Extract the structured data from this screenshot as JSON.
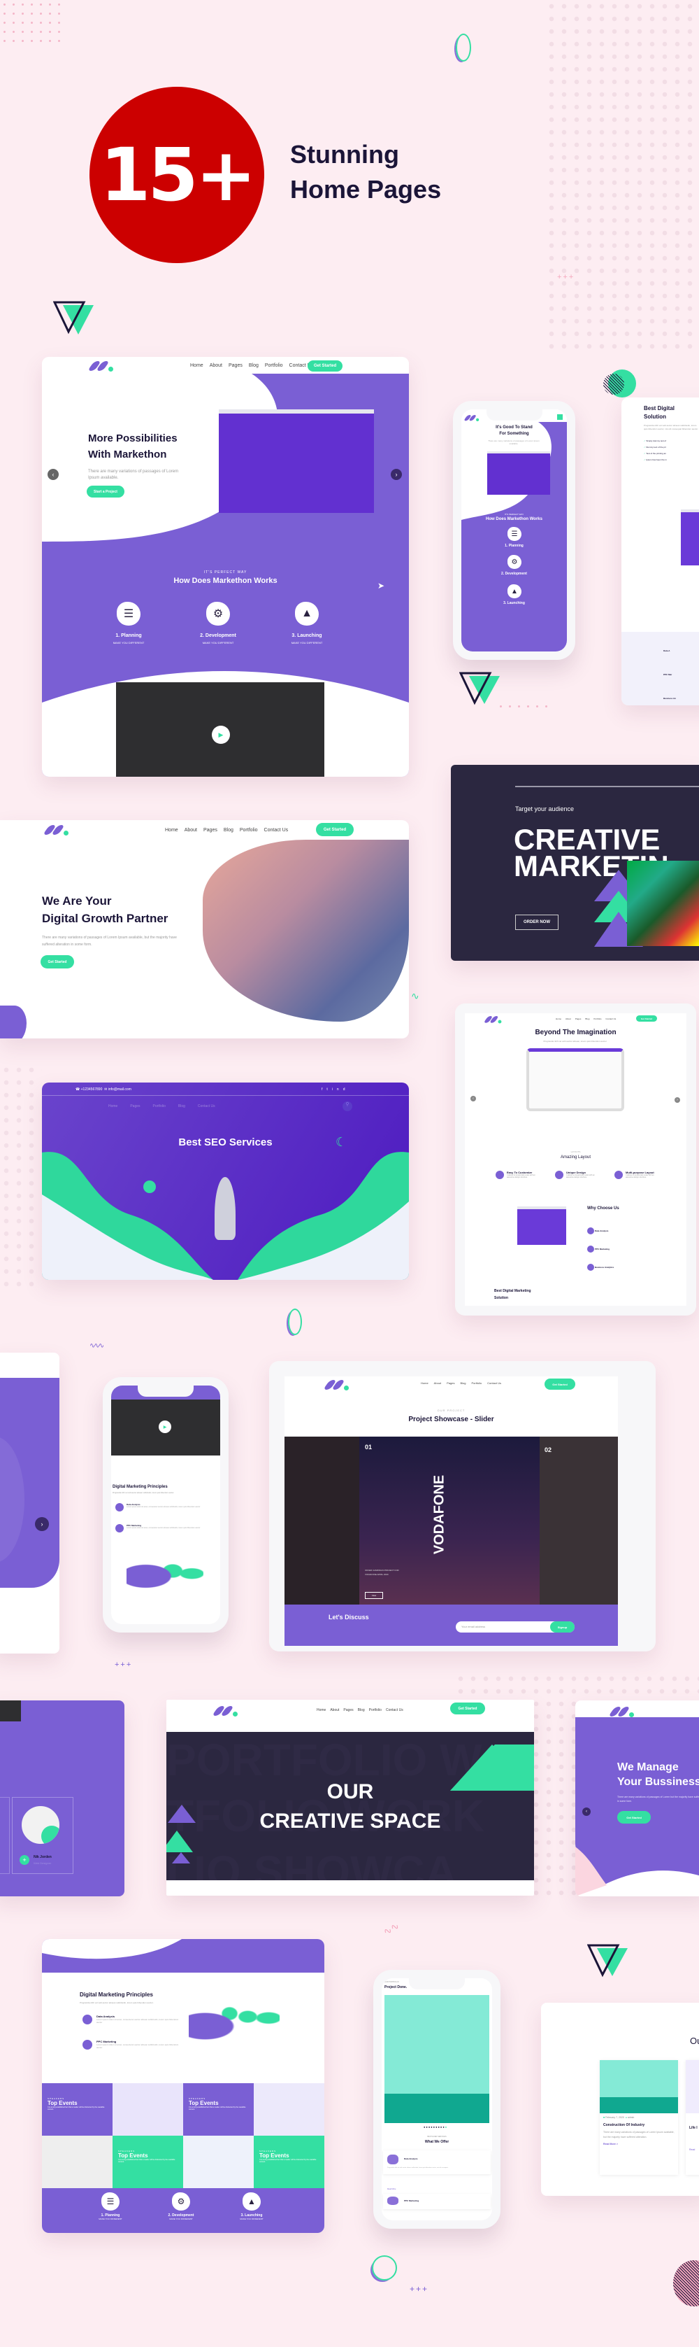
{
  "hero": {
    "badge": "15+",
    "title_line1": "Stunning",
    "title_line2": "Home Pages",
    "badge_color": "#cc0000"
  },
  "colors": {
    "purple": "#7a5fd4",
    "green": "#34dfa2",
    "dark": "#2b2740",
    "background": "#fdedf2"
  },
  "common_nav": [
    "Home",
    "About",
    "Pages",
    "Blog",
    "Portfolio",
    "Contact Us"
  ],
  "common_cta": "Get Started",
  "demo1": {
    "title_line1": "More Possibilities",
    "title_line2": "With Markethon",
    "desc": "There are many variations of passages of Lorem Ipsum available.",
    "button": "Start a Project",
    "kicker": "IT'S PERFECT WAY",
    "section_title": "How Does Markethon Works",
    "steps": [
      {
        "title": "1. Planning",
        "sub": "MAKE YOU DIFFERENT"
      },
      {
        "title": "2. Development",
        "sub": "MAKE YOU DIFFERENT"
      },
      {
        "title": "3. Launching",
        "sub": "MAKE YOU DIFFERENT"
      }
    ]
  },
  "phone1": {
    "title_line1": "It's Good To Stand",
    "title_line2": "For Something",
    "desc": "There are many variations of passages of Lorem Ipsum available.",
    "kicker": "IT'S PERFECT WAY",
    "section_title": "How Does Markethon Works",
    "steps": [
      "1. Planning",
      "2. Development",
      "3. Launching"
    ],
    "step_sub": "MAKE YOU DIFFERENT"
  },
  "partial_right1": {
    "title_line1": "Best Digital",
    "title_line2": "Solution",
    "desc": "Progravida nibh vel velit auctor alinean sollicitudin, lorem quis bibendum auctor, nisi elit consequat bibendum auctor.",
    "checks": [
      "Simply dummy text of",
      "Dummy text of the pri",
      "Text of the printing an",
      "Ipsum has been the in"
    ],
    "features": [
      "Data A",
      "PPC Mar",
      "Business An"
    ]
  },
  "demo2": {
    "title_line1": "We Are Your",
    "title_line2": "Digital Growth Partner",
    "desc": "There are many variations of passages of Lorem Ipsum available, but the majority have suffered alteration in some form.",
    "button": "Get Started"
  },
  "demo3": {
    "kicker": "Target your audience",
    "title_line1": "CREATIVE",
    "title_line2": "MARKETIN",
    "button": "ORDER NOW"
  },
  "demo4": {
    "phone": "+1234567890",
    "email": "info@mail.com",
    "nav": [
      "Home",
      "Pages",
      "Portfolio",
      "Blog",
      "Contact Us"
    ],
    "social": [
      "f",
      "t",
      "in",
      "d"
    ],
    "title": "Best SEO Services"
  },
  "tablet1": {
    "title": "Beyond The Imagination",
    "desc": "Progravida nibh vel velit auctor alinean, lorem quis bibendum auctor.",
    "kicker": "LAYOUTS",
    "section_title": "Amazing Layout",
    "features": [
      {
        "title": "Easy To Customize",
        "desc": "It allows to dynamically scale with an awesome design structure."
      },
      {
        "title": "Unique Design",
        "desc": "It allows to dynamically scale with an awesome design structure."
      },
      {
        "title": "Multi-purpose Layout",
        "desc": "It allows to dynamically scale with an awesome design structure."
      }
    ],
    "why_title": "Why Choose Us",
    "why_items": [
      "Data Analysis",
      "PPC Marketing",
      "Business Analytics"
    ],
    "bottom_title_line1": "Best Digital Marketing",
    "bottom_title_line2": "Solution"
  },
  "phone2": {
    "title": "Digital Marketing Principles",
    "desc": "Progravida nibh vel velit auctor alinean sollicitudin, lorem quis bibendum auctor.",
    "items": [
      {
        "title": "Data Analysis",
        "desc": "Lorem ipsum dolor sit amet, consectetur auctor alinean sollicitudin, lorem quis bibendum auctor"
      },
      {
        "title": "PPC Marketing",
        "desc": "Lorem ipsum dolor sit amet, consectetur auctor alinean sollicitudin, lorem quis bibendum auctor"
      }
    ]
  },
  "tablet2": {
    "kicker": "OUR PROJECT",
    "title": "Project Showcase - Slider",
    "slide1_num": "01",
    "slide1_title": "VODAFONE",
    "slide1_desc": "OFFER CAMPAIGN PROJECT FOR VODAFONE APRIL 2020",
    "slide1_button": "View",
    "slide2_num": "02",
    "cta_title": "Let's Discuss",
    "email_placeholder": "Your email address",
    "signup": "Signup"
  },
  "partial_left2": {
    "name": "Nik Jorden",
    "role": "Web Designer"
  },
  "demo5": {
    "bg_words": [
      "PORTFOLIO WO",
      "TFOLIO WORK",
      "LIO SHOWCA"
    ],
    "title_line1": "OUR",
    "title_line2": "CREATIVE SPACE"
  },
  "partial_right2": {
    "title_line1": "We Manage",
    "title_line2": "Your Bussiness",
    "desc": "There are many variations of passages of Lorem but the majority have suffered alteration in some form.",
    "button": "Get Started"
  },
  "demo6": {
    "title": "Digital Marketing Principles",
    "desc": "Progravida nibh vel velit auctor alinean sollicitudin, lorem quis bibendum auctor.",
    "items": [
      {
        "title": "Data Analysis",
        "desc": "Lorem ipsum dolor sit amet, consectetur auctor alinean sollicitudin, lorem quis bibendum auctor"
      },
      {
        "title": "PPC Marketing",
        "desc": "Lorem ipsum dolor sit amet, consectetur auctor alinean sollicitudin, lorem quis bibendum auctor"
      }
    ],
    "events": {
      "kicker": "SPEAKERS",
      "title": "Top Events",
      "desc": "It is a long established fact that a reader will be distracted by the readable content."
    },
    "steps": [
      {
        "title": "1. Planning",
        "sub": "MAKE YOU DIFFERENT"
      },
      {
        "title": "2. Development",
        "sub": "MAKE YOU DIFFERENT"
      },
      {
        "title": "3. Launching",
        "sub": "MAKE YOU DIFFERENT"
      }
    ]
  },
  "phone3": {
    "kicker": "OUR PORTFOLIO",
    "title": "Project Done.",
    "services_kicker": "BEST EVER SERVICES",
    "services_title": "What We Offer",
    "service1": "Data Analysis",
    "service1_desc": "Progravida nibh vel velit auctor alinean sollicitudin, lorem quis bibendum auctor, nisi elit consequat.",
    "read_more": "Read More",
    "service2": "PPC Marketing"
  },
  "blog_card": {
    "heading": "Ou",
    "date": "February 7, 2020",
    "author": "admin",
    "title": "Construction Of Industry",
    "desc": "There are many variations of passages of Lorem Ipsum available, but the majority have suffered alteration.",
    "read_more": "Read More >",
    "title2": "Life I",
    "read_more2": "Read"
  }
}
